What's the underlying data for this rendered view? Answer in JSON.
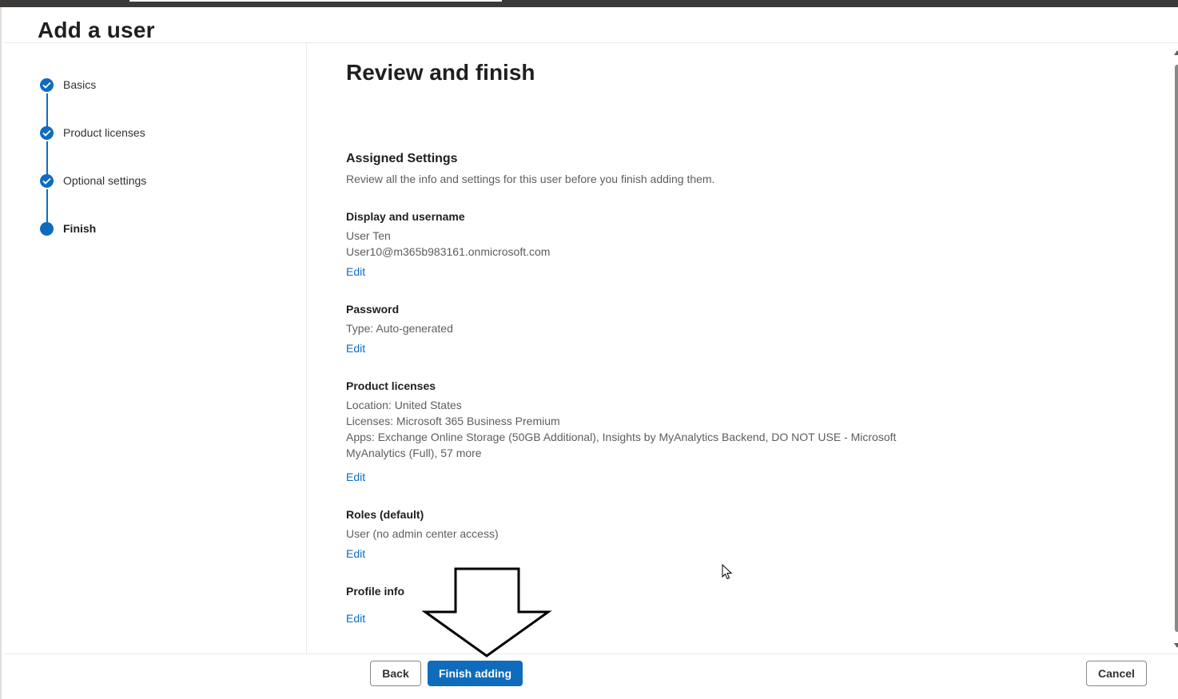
{
  "page": {
    "title": "Add a user"
  },
  "stepper": {
    "steps": [
      {
        "label": "Basics",
        "state": "completed"
      },
      {
        "label": "Product licenses",
        "state": "completed"
      },
      {
        "label": "Optional settings",
        "state": "completed"
      },
      {
        "label": "Finish",
        "state": "current"
      }
    ]
  },
  "main": {
    "heading": "Review and finish",
    "subheading": "Assigned Settings",
    "description": "Review all the info and settings for this user before you finish adding them.",
    "sections": [
      {
        "title": "Display and username",
        "lines": [
          "User Ten",
          "User10@m365b983161.onmicrosoft.com"
        ],
        "edit_label": "Edit"
      },
      {
        "title": "Password",
        "lines": [
          "Type: Auto-generated"
        ],
        "edit_label": "Edit"
      },
      {
        "title": "Product licenses",
        "lines": [
          "Location: United States",
          "Licenses: Microsoft 365 Business Premium",
          "Apps: Exchange Online Storage (50GB Additional), Insights by MyAnalytics Backend, DO NOT USE - Microsoft MyAnalytics (Full), 57 more"
        ],
        "edit_label": "Edit"
      },
      {
        "title": "Roles (default)",
        "lines": [
          "User (no admin center access)"
        ],
        "edit_label": "Edit"
      },
      {
        "title": "Profile info",
        "lines": [],
        "edit_label": "Edit"
      }
    ]
  },
  "footer": {
    "back_label": "Back",
    "finish_label": "Finish adding",
    "cancel_label": "Cancel"
  },
  "colors": {
    "accent": "#0f6cbd",
    "text_primary": "#201f1e",
    "text_secondary": "#605e5c"
  },
  "icons": [
    "checkmark-icon",
    "down-arrow-annotation-icon",
    "mouse-cursor-icon"
  ]
}
